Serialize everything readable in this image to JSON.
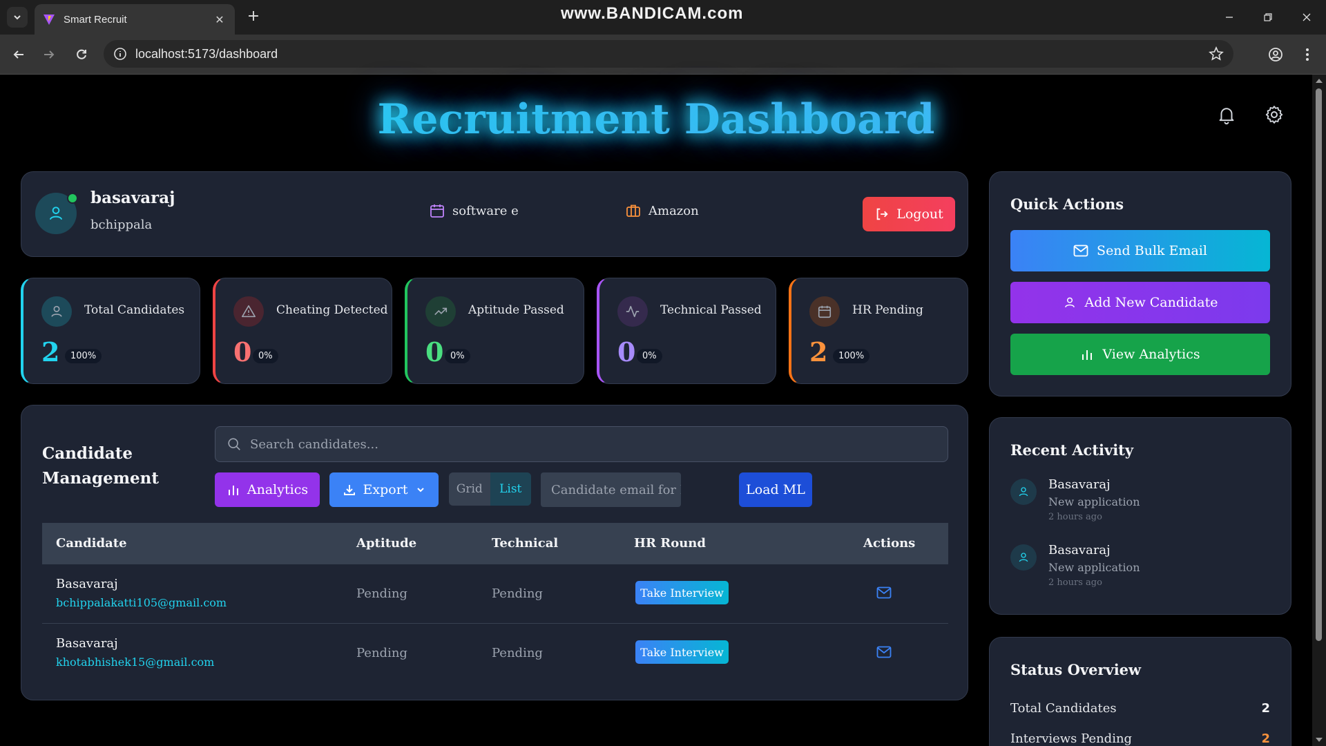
{
  "browser": {
    "tab_title": "Smart Recruit",
    "url": "localhost:5173/dashboard",
    "watermark": "www.BANDICAM.com"
  },
  "header": {
    "title": "Recruitment Dashboard"
  },
  "profile": {
    "name": "basavaraj",
    "username": "bchippala",
    "role": "software e",
    "company": "Amazon",
    "logout_label": "Logout"
  },
  "stats": [
    {
      "label": "Total Candidates",
      "value": "2",
      "percent": "100%",
      "color": "#22d3ee"
    },
    {
      "label": "Cheating Detected",
      "value": "0",
      "percent": "0%",
      "color": "#f87171"
    },
    {
      "label": "Aptitude Passed",
      "value": "0",
      "percent": "0%",
      "color": "#4ade80"
    },
    {
      "label": "Technical Passed",
      "value": "0",
      "percent": "0%",
      "color": "#a78bfa"
    },
    {
      "label": "HR Pending",
      "value": "2",
      "percent": "100%",
      "color": "#fb923c"
    }
  ],
  "candidate_management": {
    "title": "Candidate Management",
    "search_placeholder": "Search candidates...",
    "analytics_label": "Analytics",
    "export_label": "Export",
    "view_grid": "Grid",
    "view_list": "List",
    "ml_placeholder": "Candidate email for ML",
    "load_ml_label": "Load ML",
    "columns": [
      "Candidate",
      "Aptitude",
      "Technical",
      "HR Round",
      "Actions"
    ],
    "rows": [
      {
        "name": "Basavaraj",
        "email": "bchippalakatti105@gmail.com",
        "aptitude": "Pending",
        "technical": "Pending",
        "hr_action": "Take Interview"
      },
      {
        "name": "Basavaraj",
        "email": "khotabhishek15@gmail.com",
        "aptitude": "Pending",
        "technical": "Pending",
        "hr_action": "Take Interview"
      }
    ]
  },
  "quick_actions": {
    "title": "Quick Actions",
    "send_bulk_email": "Send Bulk Email",
    "add_new_candidate": "Add New Candidate",
    "view_analytics": "View Analytics"
  },
  "recent_activity": {
    "title": "Recent Activity",
    "items": [
      {
        "name": "Basavaraj",
        "text": "New application",
        "time": "2 hours ago"
      },
      {
        "name": "Basavaraj",
        "text": "New application",
        "time": "2 hours ago"
      }
    ]
  },
  "status_overview": {
    "title": "Status Overview",
    "rows": [
      {
        "label": "Total Candidates",
        "value": "2",
        "color": "#f3f4f6"
      },
      {
        "label": "Interviews Pending",
        "value": "2",
        "color": "#fb923c"
      }
    ]
  },
  "colors": {
    "accent": "#22d3ee",
    "card_bg": "#1e2433",
    "logout": "#ef4444",
    "analytics_btn": "#9333ea",
    "export_btn": "#3b82f6",
    "load_ml_btn": "#1d4ed8",
    "bulk_email_btn": "#3b82f6",
    "add_candidate_btn": "#9333ea",
    "view_analytics_btn": "#16a34a"
  }
}
